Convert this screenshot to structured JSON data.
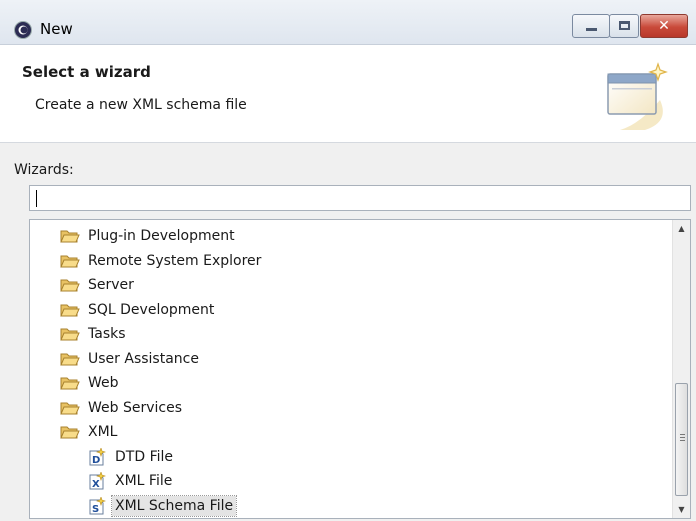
{
  "window": {
    "title": "New"
  },
  "banner": {
    "title": "Select a wizard",
    "description": "Create a new XML schema file"
  },
  "wizards": {
    "label": "Wizards:",
    "filter_value": "",
    "items": [
      {
        "label": "Plug-in Development",
        "type": "folder"
      },
      {
        "label": "Remote System Explorer",
        "type": "folder"
      },
      {
        "label": "Server",
        "type": "folder"
      },
      {
        "label": "SQL Development",
        "type": "folder"
      },
      {
        "label": "Tasks",
        "type": "folder"
      },
      {
        "label": "User Assistance",
        "type": "folder"
      },
      {
        "label": "Web",
        "type": "folder"
      },
      {
        "label": "Web Services",
        "type": "folder"
      },
      {
        "label": "XML",
        "type": "folder",
        "expanded": true
      },
      {
        "label": "DTD File",
        "type": "file",
        "icon": "dtd-file-icon",
        "badge": "D"
      },
      {
        "label": "XML File",
        "type": "file",
        "icon": "xml-file-icon",
        "badge": "X"
      },
      {
        "label": "XML Schema File",
        "type": "file",
        "icon": "xml-schema-file-icon",
        "badge": "S",
        "selected": true
      }
    ]
  },
  "colors": {
    "selection_bg": "#e4e4e4",
    "folder_fill": "#f3d27a",
    "close_button": "#c94a3a"
  }
}
